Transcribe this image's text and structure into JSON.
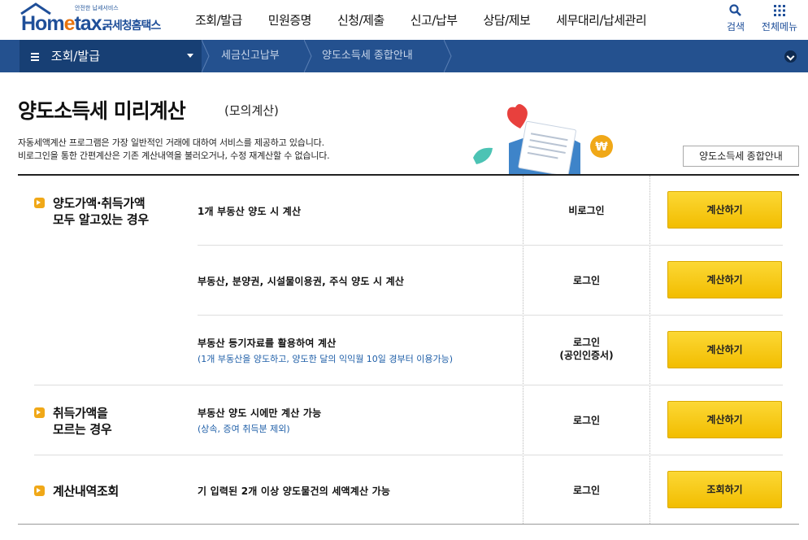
{
  "header": {
    "logo_small": "안전한 납세서비스",
    "logo_brand_a": "Hom",
    "logo_brand_e": "e",
    "logo_brand_b": "tax.",
    "logo_name": "국세청홈택스",
    "menu": [
      "조회/발급",
      "민원증명",
      "신청/제출",
      "신고/납부",
      "상담/제보",
      "세무대리/납세관리"
    ],
    "search_label": "검색",
    "allmenu_label": "전체메뉴"
  },
  "location": {
    "current": "조회/발급",
    "crumbs": [
      "세금신고납부",
      "양도소득세 종합안내"
    ]
  },
  "page": {
    "title": "양도소득세 미리계산",
    "subtitle": "(모의계산)",
    "desc_lines": [
      "자동세액계산 프로그램은 가장 일반적인 거래에 대하여 서비스를 제공하고 있습니다.",
      "비로그인을 통한 간편계산은 기존 계산내역을 불러오거나, 수정 재계산할 수 없습니다."
    ],
    "guide_button": "양도소득세 종합안내"
  },
  "table": {
    "categories": [
      {
        "lines": [
          "양도가액·취득가액",
          "모두 알고있는 경우"
        ]
      },
      {
        "lines": [
          "취득가액을",
          "모르는 경우"
        ]
      },
      {
        "lines": [
          "계산내역조회"
        ]
      }
    ],
    "rows": [
      {
        "item": "1개 부동산 양도 시 계산",
        "sub": "",
        "login": [
          "비로그인"
        ],
        "button": "계산하기"
      },
      {
        "item": "부동산, 분양권, 시설물이용권, 주식 양도 시 계산",
        "sub": "",
        "login": [
          "로그인"
        ],
        "button": "계산하기"
      },
      {
        "item": "부동산 등기자료를 활용하여 계산",
        "sub": "(1개 부동산을 양도하고, 양도한 달의 익익월 10일 경부터 이용가능)",
        "login": [
          "로그인",
          "(공인인증서)"
        ],
        "button": "계산하기"
      },
      {
        "item": "부동산 양도 시에만 계산 가능",
        "sub": "(상속, 증여 취득분 제외)",
        "login": [
          "로그인"
        ],
        "button": "계산하기"
      },
      {
        "item": "기 입력된 2개 이상 양도물건의 세액계산 가능",
        "sub": "",
        "login": [
          "로그인"
        ],
        "button": "조회하기"
      }
    ]
  },
  "colors": {
    "brand": "#1f4f99",
    "location_bar": "#24518f",
    "button_yellow": "#f5c400",
    "bullet_orange": "#f0a818"
  }
}
